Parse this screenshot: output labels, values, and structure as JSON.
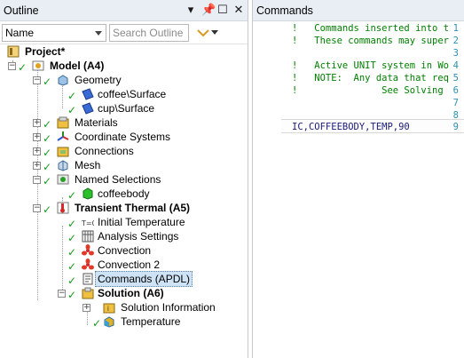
{
  "outline": {
    "title": "Outline",
    "name_select": "Name",
    "search_placeholder": "Search Outline",
    "items": [
      {
        "label": "Project*",
        "bold": true
      },
      {
        "label": "Model (A4)",
        "bold": true
      },
      {
        "label": "Geometry"
      },
      {
        "label": "coffee\\Surface"
      },
      {
        "label": "cup\\Surface"
      },
      {
        "label": "Materials"
      },
      {
        "label": "Coordinate Systems"
      },
      {
        "label": "Connections"
      },
      {
        "label": "Mesh"
      },
      {
        "label": "Named Selections"
      },
      {
        "label": "coffeebody"
      },
      {
        "label": "Transient Thermal (A5)",
        "bold": true
      },
      {
        "label": "Initial Temperature"
      },
      {
        "label": "Analysis Settings"
      },
      {
        "label": "Convection"
      },
      {
        "label": "Convection 2"
      },
      {
        "label": "Commands (APDL)",
        "selected": true
      },
      {
        "label": "Solution (A6)",
        "bold": true
      },
      {
        "label": "Solution Information"
      },
      {
        "label": "Temperature"
      }
    ]
  },
  "commands": {
    "title": "Commands",
    "lines": [
      {
        "n": "1",
        "text": "!   Commands inserted into t"
      },
      {
        "n": "2",
        "text": "!   These commands may super"
      },
      {
        "n": "3",
        "text": ""
      },
      {
        "n": "4",
        "text": "!   Active UNIT system in Wo"
      },
      {
        "n": "5",
        "text": "!   NOTE:  Any data that req"
      },
      {
        "n": "6",
        "text": "!               See Solving"
      },
      {
        "n": "7",
        "text": ""
      },
      {
        "n": "8",
        "text": ""
      },
      {
        "n": "9",
        "text": "IC,COFFEEBODY,TEMP,90"
      }
    ]
  },
  "icons": {
    "check_color": "#1a9a1a",
    "accent": "#1e7ad4",
    "selection_bg": "#cfe3f6"
  }
}
